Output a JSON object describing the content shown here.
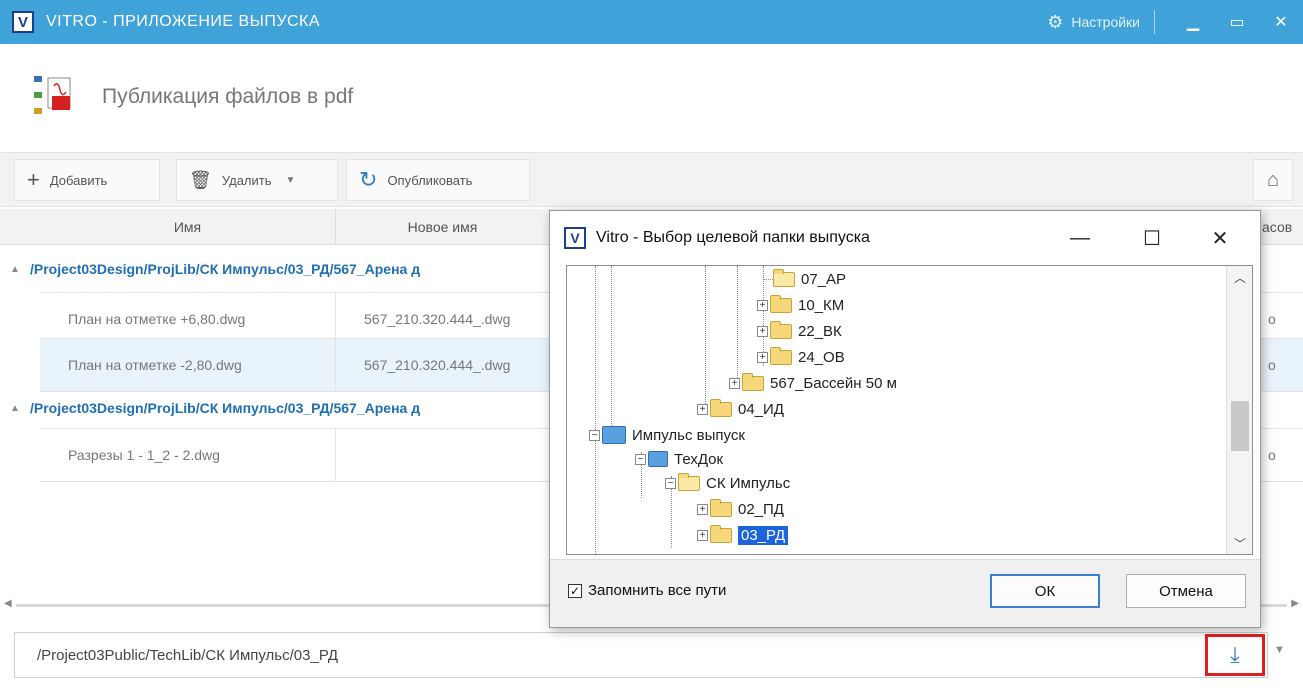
{
  "app": {
    "logo_letter": "V",
    "title": "VITRO - ПРИЛОЖЕНИЕ ВЫПУСКА",
    "settings_label": "Настройки",
    "minimize_glyph": "▁",
    "maximize_glyph": "▭",
    "close_glyph": "✕"
  },
  "page": {
    "title": "Публикация файлов в pdf"
  },
  "toolbar": {
    "add_label": "Добавить",
    "delete_label": "Удалить",
    "publish_label": "Опубликовать"
  },
  "grid": {
    "columns": [
      "Имя",
      "Новое имя",
      "асов"
    ],
    "groups": [
      {
        "path": "/Project03Design/ProjLib/СК Импульс/03_РД/567_Арена д",
        "rows": [
          {
            "name": "План на отметке +6,80.dwg",
            "new_name": "567_210.320.444_.dwg",
            "extra": "о"
          },
          {
            "name": "План на отметке -2,80.dwg",
            "new_name": "567_210.320.444_.dwg",
            "extra": "о"
          }
        ]
      },
      {
        "path": "/Project03Design/ProjLib/СК Импульс/03_РД/567_Арена д",
        "rows": [
          {
            "name": "Разрезы 1 - 1_2 - 2.dwg",
            "new_name": "",
            "extra": "о"
          }
        ]
      }
    ]
  },
  "target_path": "/Project03Public/TechLib/СК Импульс/03_РД",
  "dialog": {
    "logo_letter": "V",
    "title": "Vitro - Выбор целевой папки выпуска",
    "tree": [
      "07_АР",
      "10_КМ",
      "22_ВК",
      "24_ОВ",
      "567_Бассейн 50 м",
      "04_ИД",
      "Импульс выпуск",
      "ТехДок",
      "СК Импульс",
      "02_ПД",
      "03_РД"
    ],
    "remember_label": "Запомнить все пути",
    "ok_label": "ОК",
    "cancel_label": "Отмена"
  }
}
